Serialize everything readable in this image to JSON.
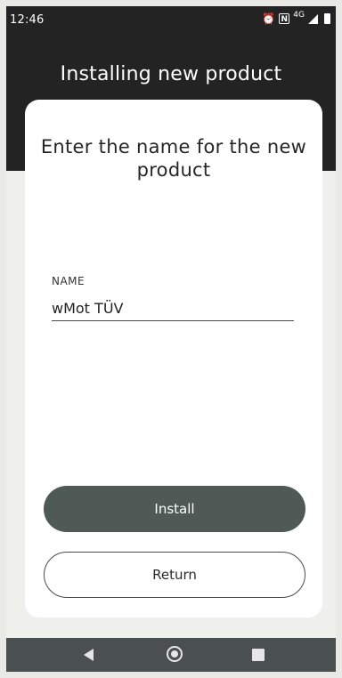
{
  "status_bar": {
    "time": "12:46",
    "network": "4G",
    "nfc_label": "N"
  },
  "header": {
    "title": "Installing new product"
  },
  "card": {
    "title": "Enter the name for the new product",
    "field_label": "NAME",
    "field_value": "wMot TÜV",
    "install_label": "Install",
    "return_label": "Return"
  },
  "colors": {
    "header_background": "#232323",
    "page_background": "#efefec",
    "card_background": "#ffffff",
    "install_button": "#4f5a57",
    "nav_bar": "#4a504f"
  },
  "icons": {
    "status": [
      "alarm-icon",
      "nfc-icon",
      "signal-icon",
      "battery-icon"
    ],
    "nav": [
      "back-icon",
      "home-icon",
      "recent-apps-icon"
    ]
  }
}
